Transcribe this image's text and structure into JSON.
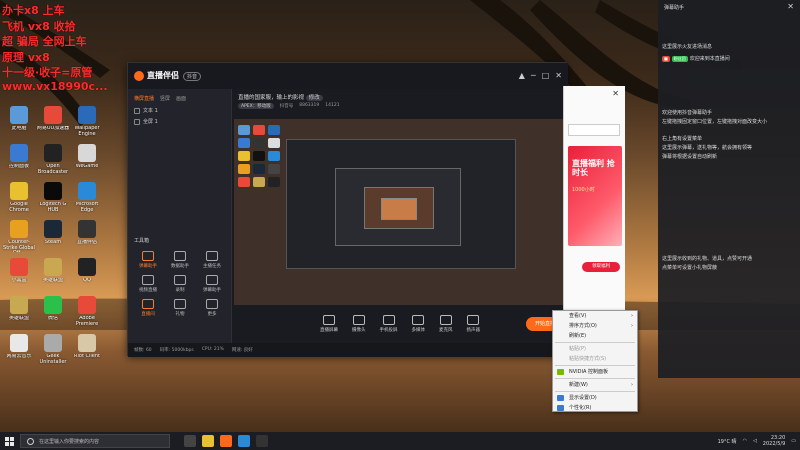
{
  "watermark": {
    "lines": [
      "办卡x8 上车",
      "飞机 vx8 收拾",
      "超 骗局 全网上车",
      "原理 vx8",
      "十一级·收子=原管",
      "www.vx18990c..."
    ]
  },
  "desktop_icons": [
    {
      "label": "此电脑",
      "color": "#5a9ad8"
    },
    {
      "label": "网易UU加速器",
      "color": "#e84a3a"
    },
    {
      "label": "Wallpaper Engine",
      "color": "#2a6ab8"
    },
    {
      "label": "控制面板",
      "color": "#3a7ad0"
    },
    {
      "label": "Open Broadcaster",
      "color": "#222222"
    },
    {
      "label": "WeGame",
      "color": "#d8d8d8"
    },
    {
      "label": "Google Chrome",
      "color": "#e8c030"
    },
    {
      "label": "Logitech G HUB",
      "color": "#0a0a0a"
    },
    {
      "label": "Microsoft Edge",
      "color": "#2a8ad8"
    },
    {
      "label": "Counter-Strike Global Off...",
      "color": "#e8a020"
    },
    {
      "label": "Steam",
      "color": "#1b2838"
    },
    {
      "label": "直播伴侣",
      "color": "#333333"
    },
    {
      "label": "小黑盒",
      "color": "#e84a3a"
    },
    {
      "label": "英雄联盟",
      "color": "#c8a850"
    },
    {
      "label": "QQ",
      "color": "#222222"
    },
    {
      "label": "英雄联盟",
      "color": "#c8a850"
    },
    {
      "label": "微信",
      "color": "#2ac04a"
    },
    {
      "label": "Adobe Premiere",
      "color": "#e84a3a"
    },
    {
      "label": "网易云音乐",
      "color": "#e8e8e8"
    },
    {
      "label": "Geek Uninstaller",
      "color": "#aaaaaa"
    },
    {
      "label": "Riot Client",
      "color": "#d8c8a8"
    }
  ],
  "app": {
    "name": "直播伴侣",
    "version": "抖音",
    "window_buttons": [
      "▲",
      "─",
      "□",
      "✕"
    ],
    "tabs": [
      "横屏直播",
      "竖屏",
      "画面"
    ],
    "scenes": [
      "文本 1",
      "全屏 1"
    ],
    "tools_title": "工具箱",
    "tools": [
      {
        "label": "弹幕助手",
        "hot": true
      },
      {
        "label": "数据助手",
        "hot": false
      },
      {
        "label": "主播任务",
        "hot": false
      },
      {
        "label": "视频直播",
        "hot": false
      },
      {
        "label": "录制",
        "hot": false
      },
      {
        "label": "弹幕助手",
        "hot": false
      },
      {
        "label": "直播间",
        "hot": true
      },
      {
        "label": "礼物",
        "hot": false
      },
      {
        "label": "更多",
        "hot": false
      }
    ],
    "stream_title": "直播的国家服，输上的影视",
    "stream_tag": "修改",
    "category": "APEX：移动版",
    "room_label": "抖音号",
    "room_id": "8863319",
    "viewers": "14121",
    "controls": [
      "直播屏幕",
      "摄像头",
      "手机投屏",
      "多媒体",
      "麦克风",
      "扬声器"
    ],
    "go_live": "开始直播",
    "status": [
      "帧数: 60",
      "码率: 5000kbps",
      "CPU: 21%",
      "网速: 良好"
    ]
  },
  "browser": {
    "close": "✕",
    "promo_title": "直播福利 抢时长",
    "promo_sub": "1000小时",
    "promo_button": "领取福利"
  },
  "context_menu": {
    "items": [
      {
        "label": "查看(V)",
        "disabled": false,
        "arrow": true
      },
      {
        "label": "排序方式(O)",
        "disabled": false,
        "arrow": true
      },
      {
        "label": "刷新(E)",
        "disabled": false,
        "arrow": false
      },
      {
        "label": "粘贴(P)",
        "disabled": true,
        "arrow": false
      },
      {
        "label": "粘贴快捷方式(S)",
        "disabled": true,
        "arrow": false
      },
      {
        "label": "NVIDIA 控制面板",
        "disabled": false,
        "arrow": false,
        "icon_color": "#76b900"
      },
      {
        "label": "新建(W)",
        "disabled": false,
        "arrow": true
      },
      {
        "label": "显示设置(D)",
        "disabled": false,
        "arrow": false,
        "icon_color": "#3a7ad0"
      },
      {
        "label": "个性化(R)",
        "disabled": false,
        "arrow": false,
        "icon_color": "#3a7ad0"
      }
    ]
  },
  "chat": {
    "title": "弹幕助手",
    "close": "✕",
    "intro": "这里展示火友进场消息",
    "entry_badge": "粉丝团",
    "entry_text": "欢迎来到本直播间",
    "tips": [
      "欢迎使用抖音弹幕助手",
      "左键拖拽固定窗口位置，左键拖拽对面改变大小",
      "右上角有设置菜单",
      "这里展示弹幕，送礼物等，航会拥有领等",
      "弹幕将根据设置自动刷新"
    ],
    "gift_notice": "这里展示收到的礼物、道具，点赞可开通",
    "gift_notice2": "点菜单可设置小礼物屏蔽"
  },
  "taskbar": {
    "search_placeholder": "在这里输入你要搜索的内容",
    "weather": "19°C 晴",
    "time": "23:20",
    "date": "2022/5/9",
    "app_colors": [
      "#444444",
      "#e8c030",
      "#ff6a1a",
      "#2a8ad8",
      "#333333"
    ]
  }
}
